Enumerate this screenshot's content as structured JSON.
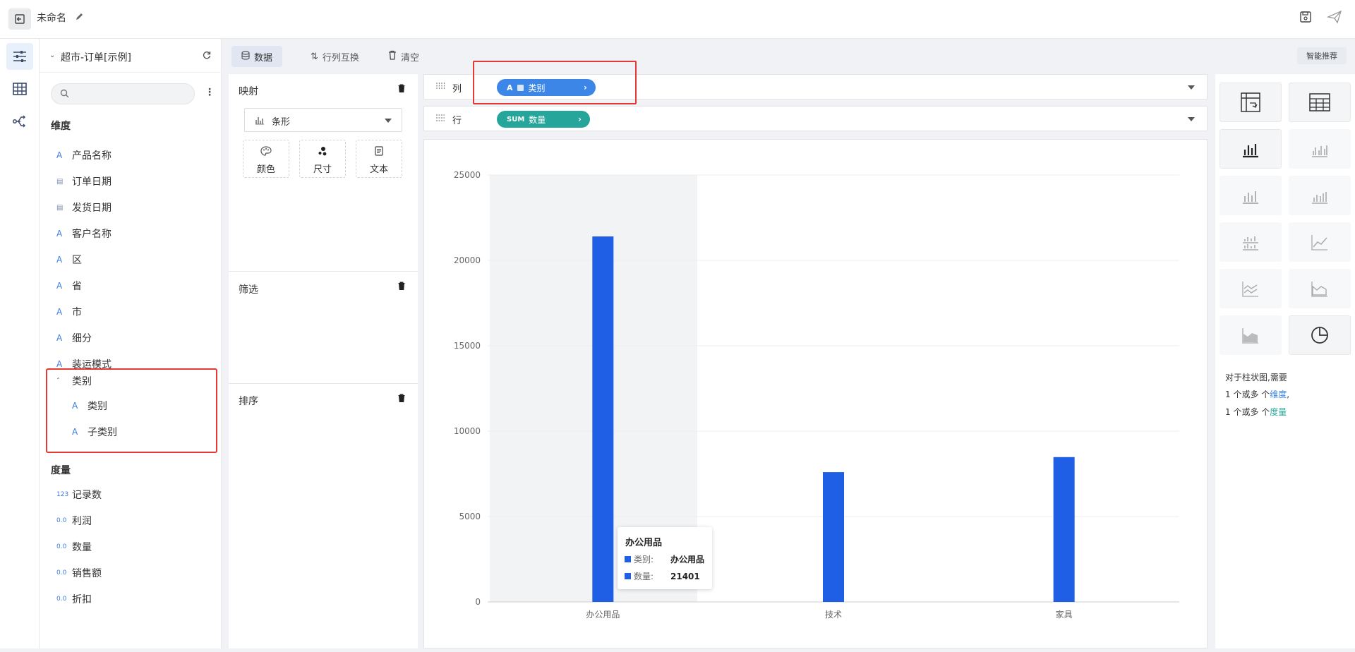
{
  "header": {
    "title": "未命名"
  },
  "datasource": {
    "name": "超市-订单[示例]",
    "search_placeholder": ""
  },
  "dimensions": {
    "title": "维度",
    "fields": [
      {
        "type": "A",
        "name": "产品名称"
      },
      {
        "type": "date",
        "name": "订单日期"
      },
      {
        "type": "date",
        "name": "发货日期"
      },
      {
        "type": "A",
        "name": "客户名称"
      },
      {
        "type": "A",
        "name": "区"
      },
      {
        "type": "A",
        "name": "省"
      },
      {
        "type": "A",
        "name": "市"
      },
      {
        "type": "A",
        "name": "细分"
      },
      {
        "type": "A",
        "name": "装运模式"
      }
    ],
    "group": {
      "name": "类别",
      "children": [
        {
          "type": "A",
          "name": "类别"
        },
        {
          "type": "A",
          "name": "子类别"
        }
      ]
    }
  },
  "measures": {
    "title": "度量",
    "fields": [
      {
        "type": "123",
        "name": "记录数"
      },
      {
        "type": "0.0",
        "name": "利润"
      },
      {
        "type": "0.0",
        "name": "数量"
      },
      {
        "type": "0.0",
        "name": "销售额"
      },
      {
        "type": "0.0",
        "name": "折扣"
      }
    ]
  },
  "toolbar": {
    "data_label": "数据",
    "swap_label": "行列互换",
    "clear_label": "清空",
    "smart_label": "智能推荐"
  },
  "mapping": {
    "title": "映射",
    "chart_type": "条形",
    "props": [
      "颜色",
      "尺寸",
      "文本"
    ],
    "filter_title": "筛选",
    "sort_title": "排序"
  },
  "shelves": {
    "columns_label": "列",
    "rows_label": "行",
    "column_pill": {
      "type": "A",
      "name": "类别"
    },
    "row_pill": {
      "agg": "SUM",
      "name": "数量"
    }
  },
  "tooltip": {
    "title": "办公用品",
    "rows": [
      {
        "key": "类别:",
        "value": "办公用品"
      },
      {
        "key": "数量:",
        "value": "21401"
      }
    ]
  },
  "hint": {
    "line1": "对于柱状图,需要",
    "line2_prefix": "1 个或多 个",
    "line2_word": "维度",
    "line2_suffix": ",",
    "line3_prefix": "1 个或多 个",
    "line3_word": "度量"
  },
  "colors": {
    "bar": "#1e5fe6",
    "dimension_pill": "#3c86e8",
    "measure_pill": "#26a69a",
    "highlight": "#e53935"
  },
  "chart_data": {
    "type": "bar",
    "categories": [
      "办公用品",
      "技术",
      "家具"
    ],
    "series": [
      {
        "values": [
          21401,
          7600,
          8480
        ]
      }
    ],
    "y_ticks": [
      0,
      5000,
      10000,
      15000,
      20000,
      25000
    ],
    "ylim": [
      0,
      25000
    ],
    "highlighted_category": "办公用品",
    "grid": true
  }
}
